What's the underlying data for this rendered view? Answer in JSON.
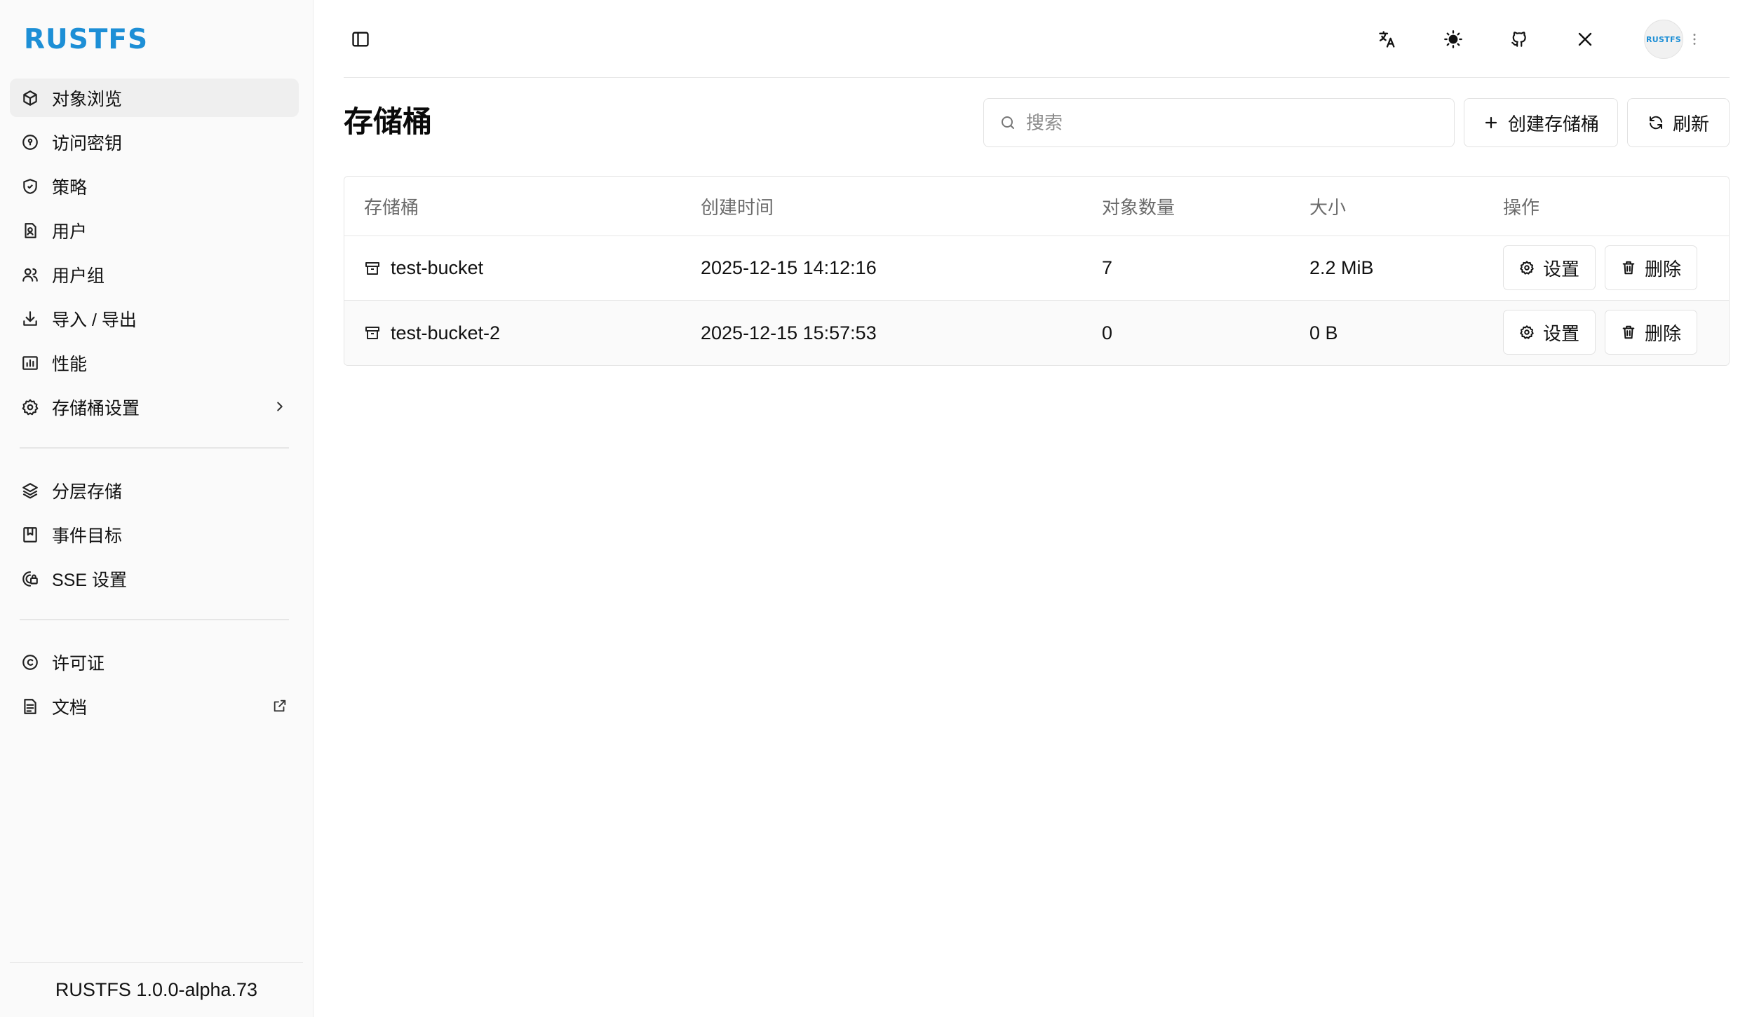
{
  "brand": {
    "logo": "RUSTFS",
    "accent": "#1d8fd6"
  },
  "sidebar": {
    "items": [
      {
        "label": "对象浏览",
        "icon": "cube-icon"
      },
      {
        "label": "访问密钥",
        "icon": "key-icon"
      },
      {
        "label": "策略",
        "icon": "shield-icon"
      },
      {
        "label": "用户",
        "icon": "user-icon"
      },
      {
        "label": "用户组",
        "icon": "users-icon"
      },
      {
        "label": "导入 / 导出",
        "icon": "download-icon"
      },
      {
        "label": "性能",
        "icon": "chart-icon"
      },
      {
        "label": "存储桶设置",
        "icon": "gear-icon"
      },
      {
        "label": "分层存储",
        "icon": "layers-icon"
      },
      {
        "label": "事件目标",
        "icon": "bookmark-icon"
      },
      {
        "label": "SSE 设置",
        "icon": "lock-icon"
      },
      {
        "label": "许可证",
        "icon": "copyright-icon"
      },
      {
        "label": "文档",
        "icon": "document-icon"
      }
    ],
    "version": "RUSTFS 1.0.0-alpha.73"
  },
  "topbar": {
    "avatar_text": "RUSTFS"
  },
  "page": {
    "title": "存储桶",
    "search_placeholder": "搜索",
    "create_label": "创建存储桶",
    "refresh_label": "刷新"
  },
  "table": {
    "columns": [
      "存储桶",
      "创建时间",
      "对象数量",
      "大小",
      "操作"
    ],
    "rows": [
      {
        "name": "test-bucket",
        "created": "2025-12-15 14:12:16",
        "objects": "7",
        "size": "2.2 MiB"
      },
      {
        "name": "test-bucket-2",
        "created": "2025-12-15 15:57:53",
        "objects": "0",
        "size": "0 B"
      }
    ],
    "settings_label": "设置",
    "delete_label": "删除"
  }
}
